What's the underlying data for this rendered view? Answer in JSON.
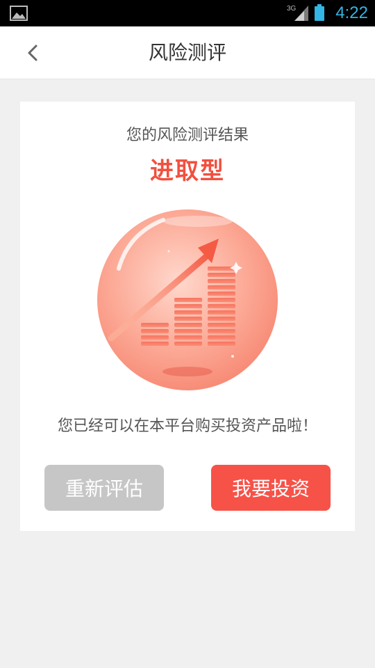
{
  "status_bar": {
    "network": "3G",
    "time": "4:22",
    "icons": [
      "gallery-icon",
      "signal-icon",
      "battery-icon"
    ]
  },
  "header": {
    "title": "风险测评",
    "back_icon": "chevron-left-icon"
  },
  "result": {
    "label": "您的风险测评结果",
    "type": "进取型",
    "illustration": "rising-bar-chart-with-arrow-icon",
    "message": "您已经可以在本平台购买投资产品啦！"
  },
  "actions": {
    "reassess_label": "重新评估",
    "invest_label": "我要投资"
  },
  "colors": {
    "accent": "#f2503f",
    "invest_button": "#f65248",
    "reassess_button": "#c6c6c6",
    "status_icon": "#33b5e5"
  }
}
